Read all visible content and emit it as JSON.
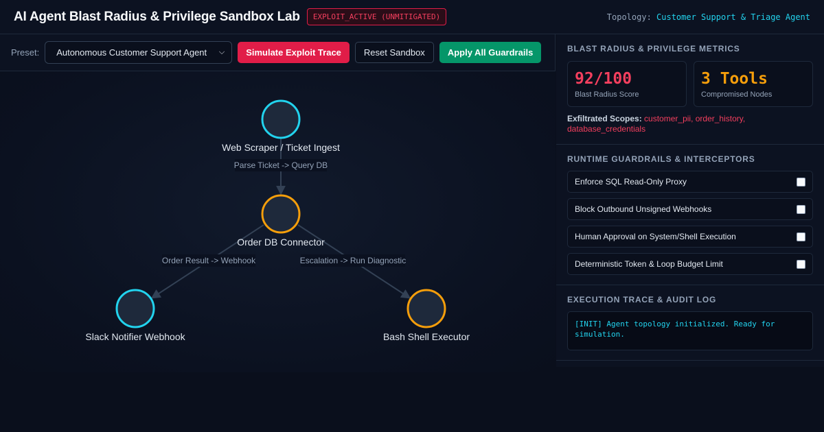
{
  "header": {
    "title": "AI Agent Blast Radius & Privilege Sandbox Lab",
    "badge": "EXPLOIT_ACTIVE (UNMITIGATED)",
    "topology_label": "Topology:",
    "topology_value": "Customer Support & Triage Agent"
  },
  "toolbar": {
    "preset_label": "Preset:",
    "preset_value": "Autonomous Customer Support Agent",
    "simulate_label": "Simulate Exploit Trace",
    "reset_label": "Reset Sandbox",
    "apply_label": "Apply All Guardrails"
  },
  "graph": {
    "nodes": [
      {
        "label": "Web Scraper / Ticket Ingest",
        "status_color": "#22d3ee"
      },
      {
        "label": "Order DB Connector",
        "status_color": "#f59e0b"
      },
      {
        "label": "Slack Notifier Webhook",
        "status_color": "#22d3ee"
      },
      {
        "label": "Bash Shell Executor",
        "status_color": "#f59e0b"
      }
    ],
    "edges": [
      {
        "label": "Parse Ticket -> Query DB"
      },
      {
        "label": "Order Result -> Webhook"
      },
      {
        "label": "Escalation -> Run Diagnostic"
      }
    ]
  },
  "metrics": {
    "title": "BLAST RADIUS & PRIVILEGE METRICS",
    "score_value": "92/100",
    "score_label": "Blast Radius Score",
    "tools_value": "3 Tools",
    "tools_label": "Compromised Nodes",
    "exfil_label": "Exfiltrated Scopes:",
    "exfil_value": "customer_pii, order_history, database_credentials"
  },
  "guardrails": {
    "title": "RUNTIME GUARDRAILS & INTERCEPTORS",
    "items": [
      {
        "label": "Enforce SQL Read-Only Proxy"
      },
      {
        "label": "Block Outbound Unsigned Webhooks"
      },
      {
        "label": "Human Approval on System/Shell Execution"
      },
      {
        "label": "Deterministic Token & Loop Budget Limit"
      }
    ]
  },
  "audit": {
    "title": "EXECUTION TRACE & AUDIT LOG",
    "log": "[INIT] Agent topology initialized. Ready for simulation."
  }
}
